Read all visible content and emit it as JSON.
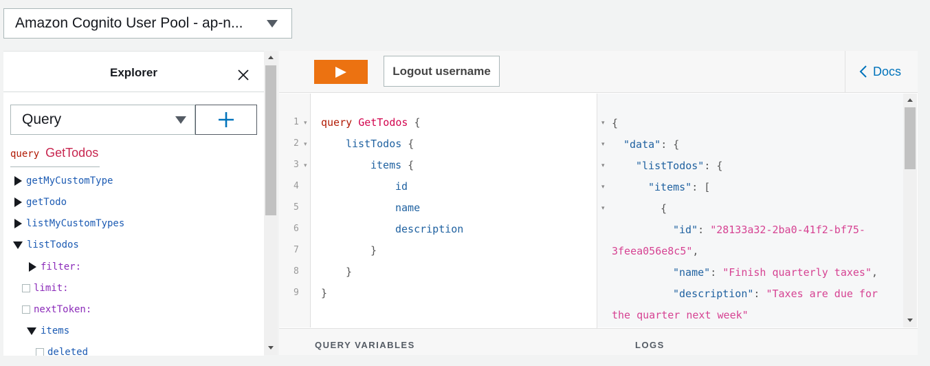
{
  "auth_select": {
    "label": "Amazon Cognito User Pool - ap-n..."
  },
  "explorer": {
    "title": "Explorer",
    "operation_type": "Query",
    "op_keyword": "query",
    "op_name": "GetTodos",
    "fields": [
      {
        "label": "getMyCustomType",
        "state": "collapsed",
        "kind": "field"
      },
      {
        "label": "getTodo",
        "state": "collapsed",
        "kind": "field"
      },
      {
        "label": "listMyCustomTypes",
        "state": "collapsed",
        "kind": "field"
      },
      {
        "label": "listTodos",
        "state": "expanded",
        "kind": "field"
      },
      {
        "label": "filter:",
        "state": "collapsed",
        "kind": "arg"
      },
      {
        "label": "limit:",
        "state": "unchecked",
        "kind": "arg"
      },
      {
        "label": "nextToken:",
        "state": "unchecked",
        "kind": "arg"
      },
      {
        "label": "items",
        "state": "expanded",
        "kind": "field"
      },
      {
        "label": "deleted",
        "state": "unchecked",
        "kind": "field"
      }
    ]
  },
  "toolbar": {
    "run_icon": "play-icon",
    "logout_label": "Logout username",
    "docs_label": "Docs",
    "run_color": "#ec7211"
  },
  "editor": {
    "line_numbers": [
      "1",
      "2",
      "3",
      "4",
      "5",
      "6",
      "7",
      "8",
      "9"
    ],
    "lines": [
      {
        "kw": "query",
        "name": "GetTodos",
        "tail": " {"
      },
      {
        "field": "listTodos",
        "tail": " {"
      },
      {
        "field": "items",
        "tail": " {"
      },
      {
        "field": "id"
      },
      {
        "field": "name"
      },
      {
        "field": "description"
      },
      {
        "tail": "}"
      },
      {
        "tail": "}"
      },
      {
        "tail": "}"
      }
    ]
  },
  "result": {
    "lines": [
      {
        "p": "{"
      },
      {
        "key": "\"data\"",
        "p": ": {"
      },
      {
        "key": "\"listTodos\"",
        "p": ": {"
      },
      {
        "key": "\"items\"",
        "p": ": ["
      },
      {
        "p": "{"
      },
      {
        "key": "\"id\"",
        "p": ": ",
        "str": "\"28133a32-2ba0-41f2-bf75-"
      },
      {
        "str": "3feea056e8c5\"",
        "p": ","
      },
      {
        "key": "\"name\"",
        "p": ": ",
        "str": "\"Finish quarterly taxes\"",
        "p2": ","
      },
      {
        "key": "\"description\"",
        "p": ": ",
        "str": "\"Taxes are due for"
      },
      {
        "str": "the quarter next week\""
      }
    ]
  },
  "bottom": {
    "query_variables_label": "QUERY VARIABLES",
    "logs_label": "LOGS"
  }
}
